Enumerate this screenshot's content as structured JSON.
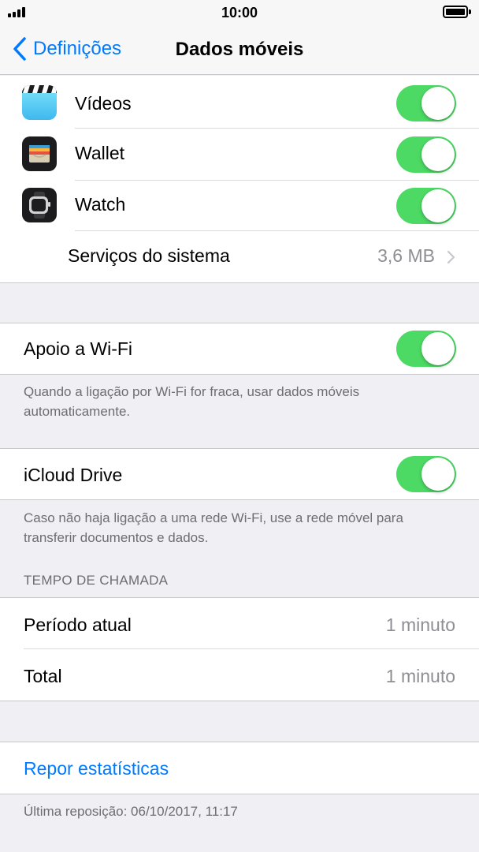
{
  "status_bar": {
    "time": "10:00",
    "signal_icon": "signal-bars-icon",
    "battery_icon": "battery-full-icon"
  },
  "nav": {
    "back_label": "Definições",
    "title": "Dados móveis"
  },
  "apps": [
    {
      "label": "Vídeos",
      "icon": "videos-app-icon",
      "enabled": true
    },
    {
      "label": "Wallet",
      "icon": "wallet-app-icon",
      "enabled": true
    },
    {
      "label": "Watch",
      "icon": "watch-app-icon",
      "enabled": true
    }
  ],
  "system_services": {
    "label": "Serviços do sistema",
    "value": "3,6 MB"
  },
  "wifi_assist": {
    "label": "Apoio a Wi-Fi",
    "enabled": true,
    "footnote": "Quando a ligação por Wi-Fi for fraca, usar dados móveis automaticamente."
  },
  "icloud_drive": {
    "label": "iCloud Drive",
    "enabled": true,
    "footnote": "Caso não haja ligação a uma rede Wi-Fi, use a rede móvel para transferir documentos e dados."
  },
  "call_time": {
    "header": "TEMPO DE CHAMADA",
    "rows": [
      {
        "label": "Período atual",
        "value": "1 minuto"
      },
      {
        "label": "Total",
        "value": "1 minuto"
      }
    ]
  },
  "reset": {
    "label": "Repor estatísticas",
    "last_reset": "Última reposição: 06/10/2017, 11:17"
  },
  "colors": {
    "accent": "#007aff",
    "toggle_on": "#4cd964",
    "background": "#efeff4"
  }
}
